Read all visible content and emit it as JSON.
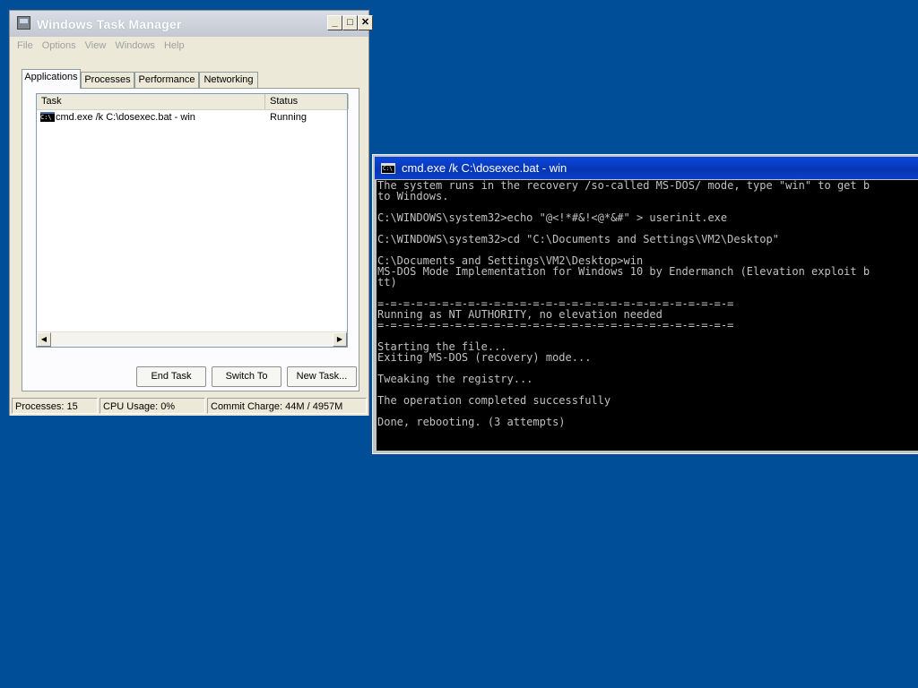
{
  "taskmgr": {
    "title": "Windows Task Manager",
    "caption_buttons": [
      "minimize-icon",
      "maximize-icon",
      "close-icon"
    ],
    "menu": [
      "File",
      "Options",
      "View",
      "Windows",
      "Help"
    ],
    "tabs": [
      "Applications",
      "Processes",
      "Performance",
      "Networking"
    ],
    "active_tab": "Applications",
    "columns": [
      "Task",
      "Status"
    ],
    "rows": [
      {
        "task": "cmd.exe /k C:\\dosexec.bat - win",
        "status": "Running",
        "icon": "console-icon"
      }
    ],
    "buttons": [
      "End Task",
      "Switch To",
      "New Task..."
    ],
    "status": {
      "processes": "Processes: 15",
      "cpu": "CPU Usage: 0%",
      "commit": "Commit Charge: 44M / 4957M"
    }
  },
  "cmd": {
    "title": "cmd.exe /k C:\\dosexec.bat - win",
    "lines": [
      "The system runs in the recovery /so-called MS-DOS/ mode, type \"win\" to get b",
      "to Windows.",
      "",
      "C:\\WINDOWS\\system32>echo \"@<!*#&!<@*&#\" > userinit.exe",
      "",
      "C:\\WINDOWS\\system32>cd \"C:\\Documents and Settings\\VM2\\Desktop\"",
      "",
      "C:\\Documents and Settings\\VM2\\Desktop>win",
      "MS-DOS Mode Implementation for Windows 10 by Endermanch (Elevation exploit b",
      "tt)",
      "",
      "=-=-=-=-=-=-=-=-=-=-=-=-=-=-=-=-=-=-=-=-=-=-=-=-=-=-=-=",
      "Running as NT AUTHORITY, no elevation needed",
      "=-=-=-=-=-=-=-=-=-=-=-=-=-=-=-=-=-=-=-=-=-=-=-=-=-=-=-=",
      "",
      "Starting the file...",
      "Exiting MS-DOS (recovery) mode...",
      "",
      "Tweaking the registry...",
      "",
      "The operation completed successfully",
      "",
      "Done, rebooting. (3 attempts)"
    ]
  },
  "colors": {
    "desktop": "#004e98",
    "console_bg": "#000000",
    "console_fg": "#c0c0c0",
    "cmd_titlebar": "#0a3fc4"
  }
}
